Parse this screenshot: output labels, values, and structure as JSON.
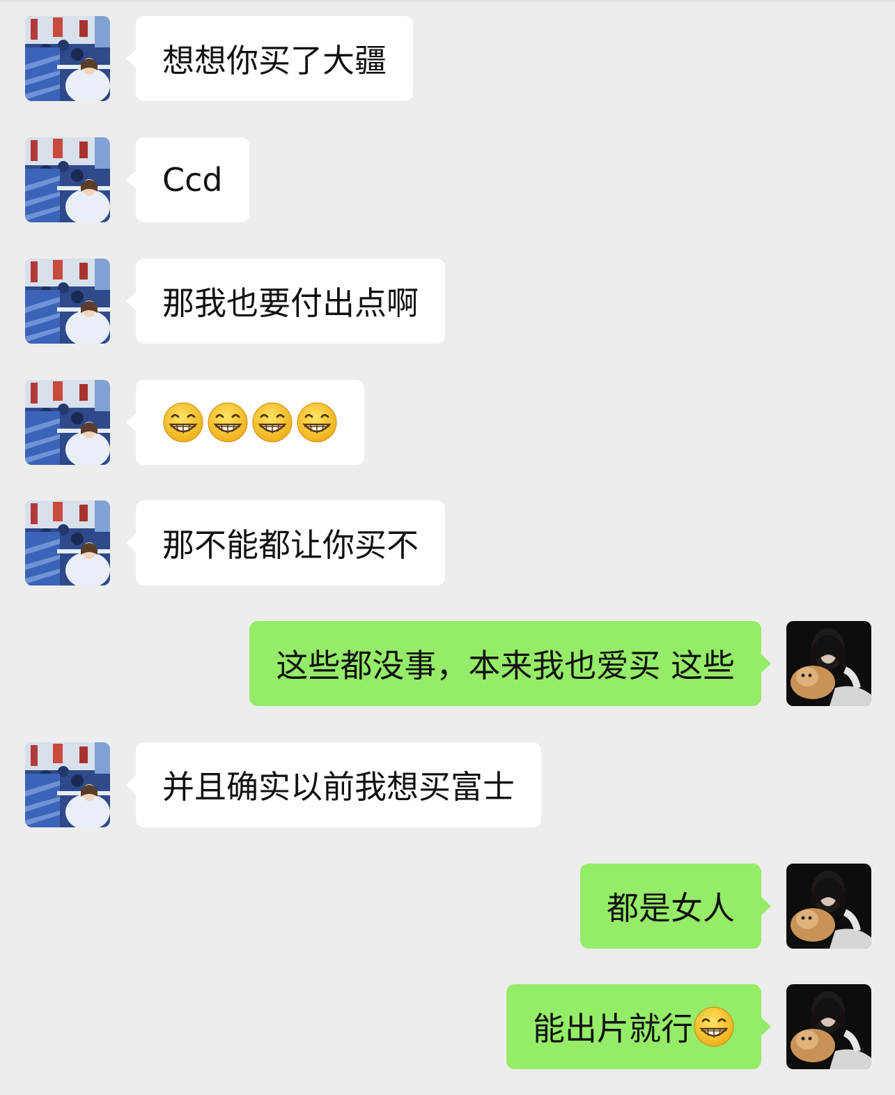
{
  "messages": [
    {
      "side": "in",
      "type": "text",
      "text": "想想你买了大疆"
    },
    {
      "side": "in",
      "type": "text",
      "text": "Ccd"
    },
    {
      "side": "in",
      "type": "text",
      "text": "那我也要付出点啊"
    },
    {
      "side": "in",
      "type": "emoji",
      "emoji": [
        "grinning-face-icon",
        "grinning-face-icon",
        "grinning-face-icon",
        "grinning-face-icon"
      ]
    },
    {
      "side": "in",
      "type": "text",
      "text": "那不能都让你买不"
    },
    {
      "side": "out",
      "type": "text",
      "text": "这些都没事，本来我也爱买 这些"
    },
    {
      "side": "in",
      "type": "text",
      "text": "并且确实以前我想买富士"
    },
    {
      "side": "out",
      "type": "text",
      "text": "都是女人"
    },
    {
      "side": "out",
      "type": "text",
      "text": "能出片就行",
      "trailing_emoji": "grinning-face-icon"
    }
  ],
  "colors": {
    "background": "#ededed",
    "incoming_bubble": "#ffffff",
    "outgoing_bubble": "#95ec69"
  }
}
